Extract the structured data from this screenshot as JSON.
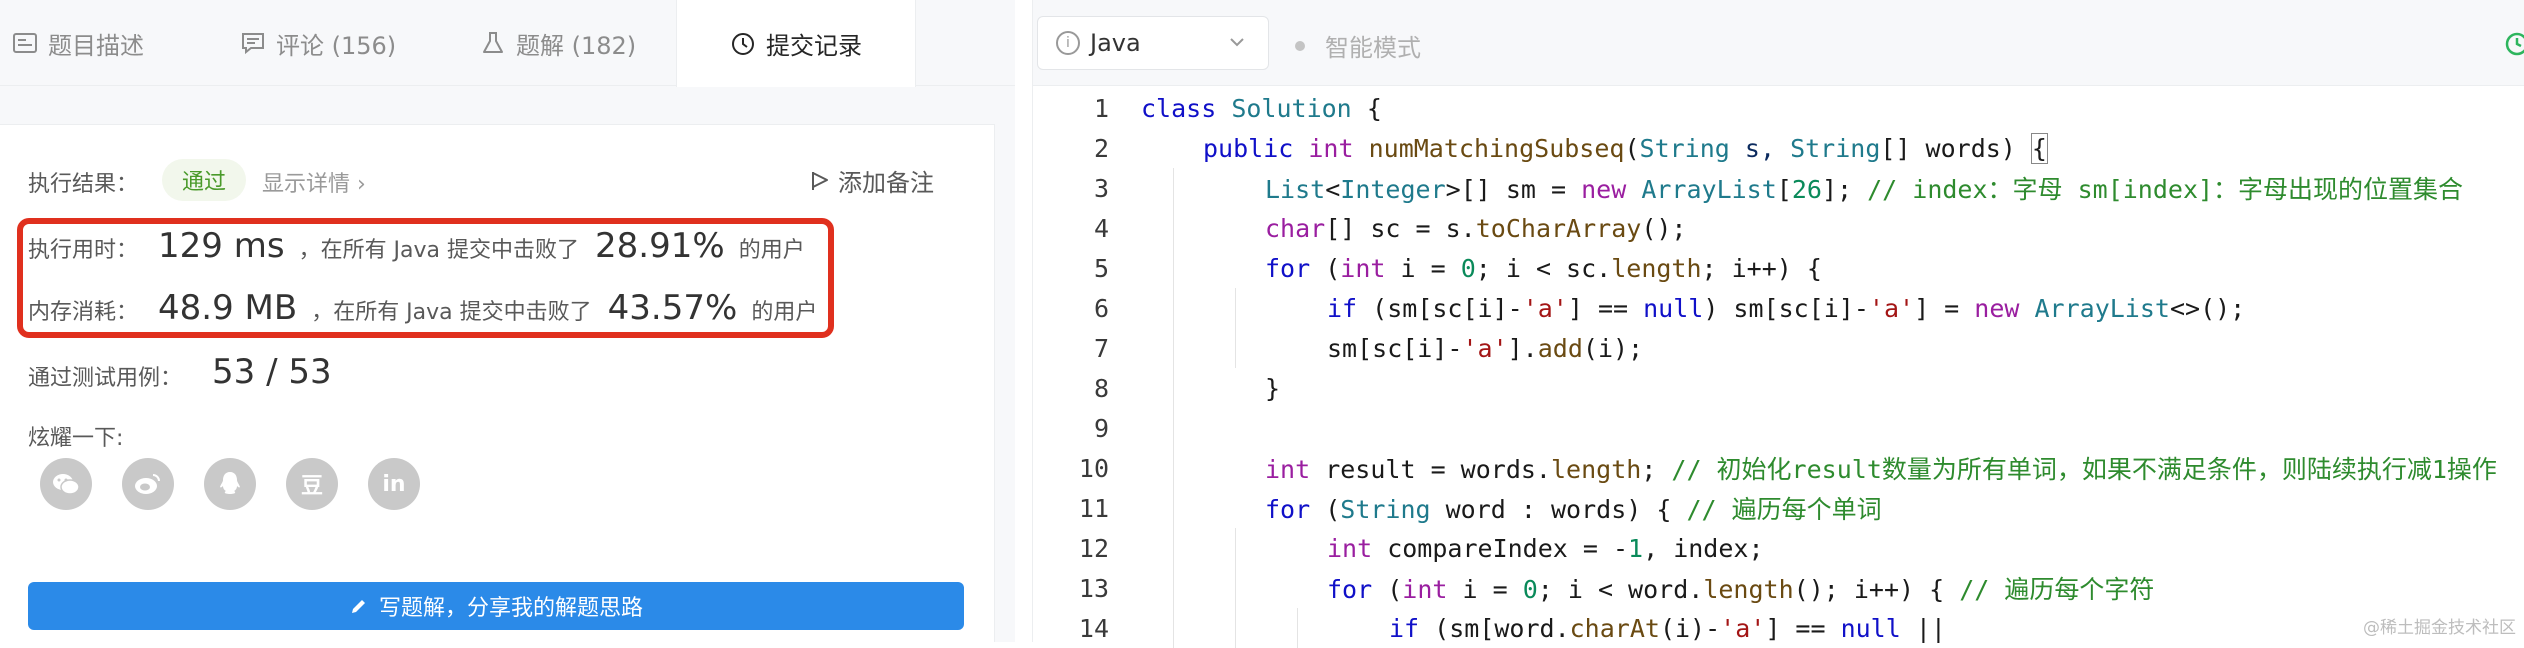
{
  "tabs": [
    {
      "label": "题目描述",
      "icon": "description-icon"
    },
    {
      "label": "评论 (156)",
      "icon": "comment-icon"
    },
    {
      "label": "题解 (182)",
      "icon": "flask-icon"
    },
    {
      "label": "提交记录",
      "icon": "clock-icon"
    }
  ],
  "result": {
    "label": "执行结果：",
    "status": "通过",
    "detail_link": "显示详情 ›",
    "note_button": "添加备注"
  },
  "stats": {
    "runtime": {
      "label": "执行用时：",
      "value": "129 ms",
      "middle": "，在所有 Java 提交中击败了",
      "percent": "28.91%",
      "tail": "的用户"
    },
    "memory": {
      "label": "内存消耗：",
      "value": "48.9 MB",
      "middle": "，在所有 Java 提交中击败了",
      "percent": "43.57%",
      "tail": "的用户"
    }
  },
  "tests": {
    "label": "通过测试用例：",
    "value": "53 / 53"
  },
  "share": {
    "label": "炫耀一下:",
    "icons": [
      "wechat-icon",
      "weibo-icon",
      "qq-icon",
      "douban-icon",
      "linkedin-icon"
    ]
  },
  "write_button": "写题解，分享我的解题思路",
  "editor": {
    "language": "Java",
    "smart_mode": "智能模式",
    "accent": "#2db55d"
  },
  "code_lines": [
    {
      "n": "1"
    },
    {
      "n": "2"
    },
    {
      "n": "3"
    },
    {
      "n": "4"
    },
    {
      "n": "5"
    },
    {
      "n": "6"
    },
    {
      "n": "7"
    },
    {
      "n": "8"
    },
    {
      "n": "9"
    },
    {
      "n": "10"
    },
    {
      "n": "11"
    },
    {
      "n": "12"
    },
    {
      "n": "13"
    },
    {
      "n": "14"
    }
  ],
  "code_tokens": {
    "l1": [
      "class",
      "Solution",
      "{"
    ],
    "l2": [
      "public",
      "int",
      "numMatchingSubseq",
      "(",
      "String",
      "s,",
      "String",
      "[] words)",
      "{"
    ],
    "l3": [
      "List",
      "<",
      "Integer",
      ">[] sm = ",
      "new",
      "ArrayList",
      "[",
      "26",
      "]; ",
      "// index：字母 sm[index]：字母出现的位置集合"
    ],
    "l4": [
      "char",
      "[] sc = s.",
      "toCharArray",
      "();"
    ],
    "l5": [
      "for",
      " (",
      "int",
      " i = ",
      "0",
      "; i < sc.",
      "length",
      "; i++) {"
    ],
    "l6": [
      "if",
      " (sm[sc[i]-",
      "'a'",
      "] == ",
      "null",
      ") sm[sc[i]-",
      "'a'",
      "] = ",
      "new",
      " ",
      "ArrayList",
      "<>();"
    ],
    "l7": [
      "sm[sc[i]-",
      "'a'",
      "].",
      "add",
      "(i);"
    ],
    "l8": [
      "}"
    ],
    "l10": [
      "int",
      " result = words.",
      "length",
      "; ",
      "// 初始化result数量为所有单词，如果不满足条件，则陆续执行减1操作"
    ],
    "l11": [
      "for",
      " (",
      "String",
      " word : words) { ",
      "// 遍历每个单词"
    ],
    "l12": [
      "int",
      " compareIndex = -",
      "1",
      ", index;"
    ],
    "l13": [
      "for",
      " (",
      "int",
      " i = ",
      "0",
      "; i < word.",
      "length",
      "(); i++) { ",
      "// 遍历每个字符"
    ],
    "l14": [
      "if",
      " (sm[word.",
      "charAt",
      "(i)-",
      "'a'",
      "] == ",
      "null",
      " ||"
    ]
  },
  "watermark": "@稀土掘金技术社区"
}
